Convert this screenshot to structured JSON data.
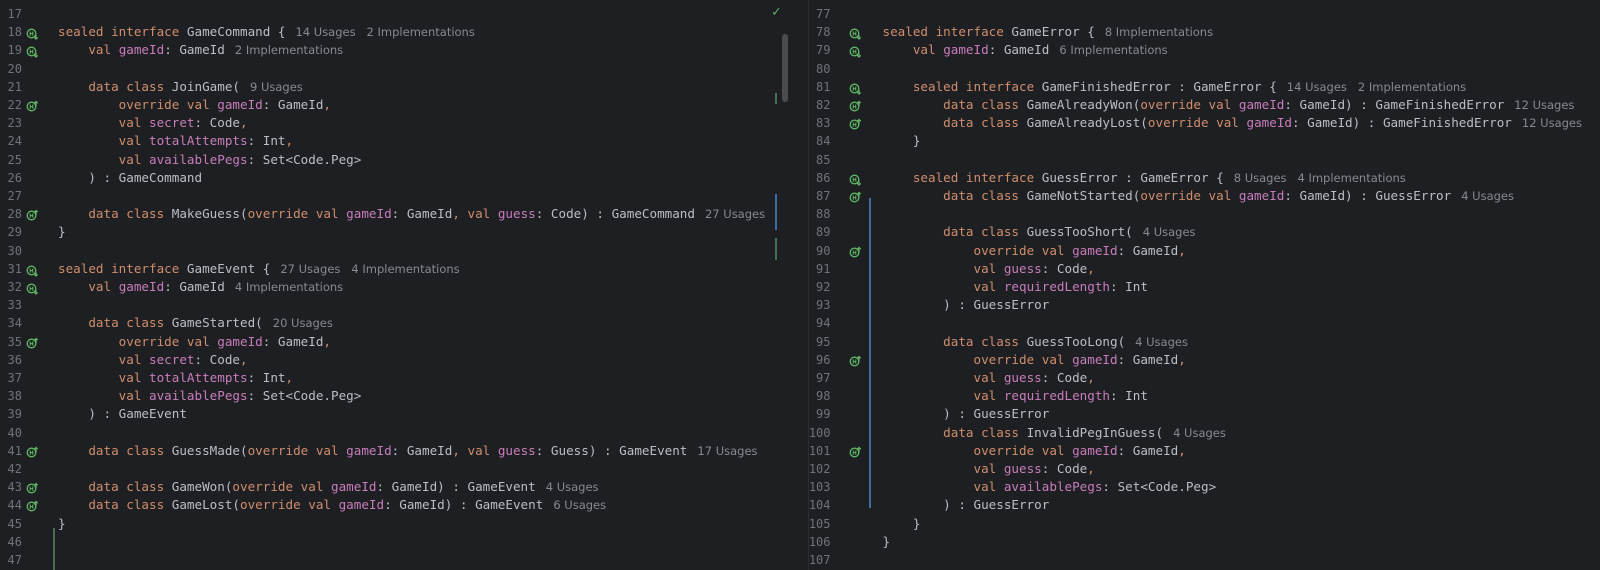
{
  "left": {
    "lines": [
      {
        "n": "17",
        "icon": "",
        "segs": []
      },
      {
        "n": "18",
        "icon": "impl",
        "segs": [
          [
            "kw",
            "sealed interface "
          ],
          [
            "ty",
            "GameCommand {"
          ]
        ],
        "hint": "14 Usages   2 Implementations"
      },
      {
        "n": "19",
        "icon": "impl",
        "segs": [
          [
            "ty",
            "    "
          ],
          [
            "kw",
            "val "
          ],
          [
            "prop",
            "gameId"
          ],
          [
            "ty",
            ": GameId"
          ]
        ],
        "hint": "2 Implementations"
      },
      {
        "n": "20",
        "icon": "",
        "segs": []
      },
      {
        "n": "21",
        "icon": "",
        "segs": [
          [
            "ty",
            "    "
          ],
          [
            "kw",
            "data class "
          ],
          [
            "ty",
            "JoinGame("
          ]
        ],
        "hint": "9 Usages"
      },
      {
        "n": "22",
        "icon": "override",
        "segs": [
          [
            "ty",
            "        "
          ],
          [
            "kw",
            "override val "
          ],
          [
            "prop",
            "gameId"
          ],
          [
            "ty",
            ": GameId"
          ],
          [
            "kw",
            ","
          ]
        ]
      },
      {
        "n": "23",
        "icon": "",
        "segs": [
          [
            "ty",
            "        "
          ],
          [
            "kw",
            "val "
          ],
          [
            "prop",
            "secret"
          ],
          [
            "ty",
            ": Code"
          ],
          [
            "kw",
            ","
          ]
        ]
      },
      {
        "n": "24",
        "icon": "",
        "segs": [
          [
            "ty",
            "        "
          ],
          [
            "kw",
            "val "
          ],
          [
            "prop",
            "totalAttempts"
          ],
          [
            "ty",
            ": Int"
          ],
          [
            "kw",
            ","
          ]
        ]
      },
      {
        "n": "25",
        "icon": "",
        "segs": [
          [
            "ty",
            "        "
          ],
          [
            "kw",
            "val "
          ],
          [
            "prop",
            "availablePegs"
          ],
          [
            "ty",
            ": Set<Code.Peg>"
          ]
        ]
      },
      {
        "n": "26",
        "icon": "",
        "segs": [
          [
            "ty",
            "    ) : GameCommand"
          ]
        ]
      },
      {
        "n": "27",
        "icon": "",
        "segs": []
      },
      {
        "n": "28",
        "icon": "override",
        "segs": [
          [
            "ty",
            "    "
          ],
          [
            "kw",
            "data class "
          ],
          [
            "ty",
            "MakeGuess("
          ],
          [
            "kw",
            "override val "
          ],
          [
            "prop",
            "gameId"
          ],
          [
            "ty",
            ": GameId"
          ],
          [
            "kw",
            ", val "
          ],
          [
            "prop",
            "guess"
          ],
          [
            "ty",
            ": Code) : GameCommand"
          ]
        ],
        "hint": "27 Usages"
      },
      {
        "n": "29",
        "icon": "",
        "segs": [
          [
            "ty",
            "}"
          ]
        ]
      },
      {
        "n": "30",
        "icon": "",
        "segs": []
      },
      {
        "n": "31",
        "icon": "impl",
        "segs": [
          [
            "kw",
            "sealed interface "
          ],
          [
            "ty",
            "GameEvent {"
          ]
        ],
        "hint": "27 Usages   4 Implementations"
      },
      {
        "n": "32",
        "icon": "impl",
        "segs": [
          [
            "ty",
            "    "
          ],
          [
            "kw",
            "val "
          ],
          [
            "prop",
            "gameId"
          ],
          [
            "ty",
            ": GameId"
          ]
        ],
        "hint": "4 Implementations"
      },
      {
        "n": "33",
        "icon": "",
        "segs": []
      },
      {
        "n": "34",
        "icon": "",
        "segs": [
          [
            "ty",
            "    "
          ],
          [
            "kw",
            "data class "
          ],
          [
            "ty",
            "GameStarted("
          ]
        ],
        "hint": "20 Usages"
      },
      {
        "n": "35",
        "icon": "override",
        "segs": [
          [
            "ty",
            "        "
          ],
          [
            "kw",
            "override val "
          ],
          [
            "prop",
            "gameId"
          ],
          [
            "ty",
            ": GameId"
          ],
          [
            "kw",
            ","
          ]
        ]
      },
      {
        "n": "36",
        "icon": "",
        "segs": [
          [
            "ty",
            "        "
          ],
          [
            "kw",
            "val "
          ],
          [
            "prop",
            "secret"
          ],
          [
            "ty",
            ": Code"
          ],
          [
            "kw",
            ","
          ]
        ]
      },
      {
        "n": "37",
        "icon": "",
        "segs": [
          [
            "ty",
            "        "
          ],
          [
            "kw",
            "val "
          ],
          [
            "prop",
            "totalAttempts"
          ],
          [
            "ty",
            ": Int"
          ],
          [
            "kw",
            ","
          ]
        ]
      },
      {
        "n": "38",
        "icon": "",
        "segs": [
          [
            "ty",
            "        "
          ],
          [
            "kw",
            "val "
          ],
          [
            "prop",
            "availablePegs"
          ],
          [
            "ty",
            ": Set<Code.Peg>"
          ]
        ]
      },
      {
        "n": "39",
        "icon": "",
        "segs": [
          [
            "ty",
            "    ) : GameEvent"
          ]
        ]
      },
      {
        "n": "40",
        "icon": "",
        "segs": []
      },
      {
        "n": "41",
        "icon": "override",
        "segs": [
          [
            "ty",
            "    "
          ],
          [
            "kw",
            "data class "
          ],
          [
            "ty",
            "GuessMade("
          ],
          [
            "kw",
            "override val "
          ],
          [
            "prop",
            "gameId"
          ],
          [
            "ty",
            ": GameId"
          ],
          [
            "kw",
            ", val "
          ],
          [
            "prop",
            "guess"
          ],
          [
            "ty",
            ": Guess) : GameEvent"
          ]
        ],
        "hint": "17 Usages"
      },
      {
        "n": "42",
        "icon": "",
        "segs": []
      },
      {
        "n": "43",
        "icon": "override",
        "segs": [
          [
            "ty",
            "    "
          ],
          [
            "kw",
            "data class "
          ],
          [
            "ty",
            "GameWon("
          ],
          [
            "kw",
            "override val "
          ],
          [
            "prop",
            "gameId"
          ],
          [
            "ty",
            ": GameId) : GameEvent"
          ]
        ],
        "hint": "4 Usages"
      },
      {
        "n": "44",
        "icon": "override",
        "segs": [
          [
            "ty",
            "    "
          ],
          [
            "kw",
            "data class "
          ],
          [
            "ty",
            "GameLost("
          ],
          [
            "kw",
            "override val "
          ],
          [
            "prop",
            "gameId"
          ],
          [
            "ty",
            ": GameId) : GameEvent"
          ]
        ],
        "hint": "6 Usages"
      },
      {
        "n": "45",
        "icon": "",
        "segs": [
          [
            "ty",
            "}"
          ]
        ]
      },
      {
        "n": "46",
        "icon": "",
        "segs": []
      },
      {
        "n": "47",
        "icon": "",
        "segs": []
      }
    ]
  },
  "right": {
    "lines": [
      {
        "n": "77",
        "icon": "",
        "segs": []
      },
      {
        "n": "78",
        "icon": "impl",
        "segs": [
          [
            "kw",
            "sealed interface "
          ],
          [
            "ty",
            "GameError {"
          ]
        ],
        "hint": "8 Implementations"
      },
      {
        "n": "79",
        "icon": "impl",
        "segs": [
          [
            "ty",
            "    "
          ],
          [
            "kw",
            "val "
          ],
          [
            "prop",
            "gameId"
          ],
          [
            "ty",
            ": GameId"
          ]
        ],
        "hint": "6 Implementations"
      },
      {
        "n": "80",
        "icon": "",
        "segs": []
      },
      {
        "n": "81",
        "icon": "impl",
        "segs": [
          [
            "ty",
            "    "
          ],
          [
            "kw",
            "sealed interface "
          ],
          [
            "ty",
            "GameFinishedError : GameError {"
          ]
        ],
        "hint": "14 Usages   2 Implementations"
      },
      {
        "n": "82",
        "icon": "override",
        "segs": [
          [
            "ty",
            "        "
          ],
          [
            "kw",
            "data class "
          ],
          [
            "ty",
            "GameAlreadyWon("
          ],
          [
            "kw",
            "override val "
          ],
          [
            "prop",
            "gameId"
          ],
          [
            "ty",
            ": GameId) : GameFinishedError"
          ]
        ],
        "hint": "12 Usages"
      },
      {
        "n": "83",
        "icon": "override",
        "segs": [
          [
            "ty",
            "        "
          ],
          [
            "kw",
            "data class "
          ],
          [
            "ty",
            "GameAlreadyLost("
          ],
          [
            "kw",
            "override val "
          ],
          [
            "prop",
            "gameId"
          ],
          [
            "ty",
            ": GameId) : GameFinishedError"
          ]
        ],
        "hint": "12 Usages"
      },
      {
        "n": "84",
        "icon": "",
        "segs": [
          [
            "ty",
            "    }"
          ]
        ]
      },
      {
        "n": "85",
        "icon": "",
        "segs": []
      },
      {
        "n": "86",
        "icon": "impl",
        "segs": [
          [
            "ty",
            "    "
          ],
          [
            "kw",
            "sealed interface "
          ],
          [
            "ty",
            "GuessError : GameError {"
          ]
        ],
        "hint": "8 Usages   4 Implementations"
      },
      {
        "n": "87",
        "icon": "override",
        "segs": [
          [
            "ty",
            "        "
          ],
          [
            "kw",
            "data class "
          ],
          [
            "ty",
            "GameNotStarted("
          ],
          [
            "kw",
            "override val "
          ],
          [
            "prop",
            "gameId"
          ],
          [
            "ty",
            ": GameId) : GuessError"
          ]
        ],
        "hint": "4 Usages"
      },
      {
        "n": "88",
        "icon": "",
        "segs": []
      },
      {
        "n": "89",
        "icon": "",
        "segs": [
          [
            "ty",
            "        "
          ],
          [
            "kw",
            "data class "
          ],
          [
            "ty",
            "GuessTooShort("
          ]
        ],
        "hint": "4 Usages"
      },
      {
        "n": "90",
        "icon": "override",
        "segs": [
          [
            "ty",
            "            "
          ],
          [
            "kw",
            "override val "
          ],
          [
            "prop",
            "gameId"
          ],
          [
            "ty",
            ": GameId"
          ],
          [
            "kw",
            ","
          ]
        ]
      },
      {
        "n": "91",
        "icon": "",
        "segs": [
          [
            "ty",
            "            "
          ],
          [
            "kw",
            "val "
          ],
          [
            "prop",
            "guess"
          ],
          [
            "ty",
            ": Code"
          ],
          [
            "kw",
            ","
          ]
        ]
      },
      {
        "n": "92",
        "icon": "",
        "segs": [
          [
            "ty",
            "            "
          ],
          [
            "kw",
            "val "
          ],
          [
            "prop",
            "requiredLength"
          ],
          [
            "ty",
            ": Int"
          ]
        ]
      },
      {
        "n": "93",
        "icon": "",
        "segs": [
          [
            "ty",
            "        ) : GuessError"
          ]
        ]
      },
      {
        "n": "94",
        "icon": "",
        "segs": []
      },
      {
        "n": "95",
        "icon": "",
        "segs": [
          [
            "ty",
            "        "
          ],
          [
            "kw",
            "data class "
          ],
          [
            "ty",
            "GuessTooLong("
          ]
        ],
        "hint": "4 Usages"
      },
      {
        "n": "96",
        "icon": "override",
        "segs": [
          [
            "ty",
            "            "
          ],
          [
            "kw",
            "override val "
          ],
          [
            "prop",
            "gameId"
          ],
          [
            "ty",
            ": GameId"
          ],
          [
            "kw",
            ","
          ]
        ]
      },
      {
        "n": "97",
        "icon": "",
        "segs": [
          [
            "ty",
            "            "
          ],
          [
            "kw",
            "val "
          ],
          [
            "prop",
            "guess"
          ],
          [
            "ty",
            ": Code"
          ],
          [
            "kw",
            ","
          ]
        ]
      },
      {
        "n": "98",
        "icon": "",
        "segs": [
          [
            "ty",
            "            "
          ],
          [
            "kw",
            "val "
          ],
          [
            "prop",
            "requiredLength"
          ],
          [
            "ty",
            ": Int"
          ]
        ]
      },
      {
        "n": "99",
        "icon": "",
        "segs": [
          [
            "ty",
            "        ) : GuessError"
          ]
        ]
      },
      {
        "n": "100",
        "icon": "",
        "segs": [
          [
            "ty",
            "        "
          ],
          [
            "kw",
            "data class "
          ],
          [
            "ty",
            "InvalidPegInGuess("
          ]
        ],
        "hint": "4 Usages"
      },
      {
        "n": "101",
        "icon": "override",
        "segs": [
          [
            "ty",
            "            "
          ],
          [
            "kw",
            "override val "
          ],
          [
            "prop",
            "gameId"
          ],
          [
            "ty",
            ": GameId"
          ],
          [
            "kw",
            ","
          ]
        ]
      },
      {
        "n": "102",
        "icon": "",
        "segs": [
          [
            "ty",
            "            "
          ],
          [
            "kw",
            "val "
          ],
          [
            "prop",
            "guess"
          ],
          [
            "ty",
            ": Code"
          ],
          [
            "kw",
            ","
          ]
        ]
      },
      {
        "n": "103",
        "icon": "",
        "segs": [
          [
            "ty",
            "            "
          ],
          [
            "kw",
            "val "
          ],
          [
            "prop",
            "availablePegs"
          ],
          [
            "ty",
            ": Set<Code.Peg>"
          ]
        ]
      },
      {
        "n": "104",
        "icon": "",
        "segs": [
          [
            "ty",
            "        ) : GuessError"
          ]
        ]
      },
      {
        "n": "105",
        "icon": "",
        "segs": [
          [
            "ty",
            "    }"
          ]
        ]
      },
      {
        "n": "106",
        "icon": "",
        "segs": [
          [
            "ty",
            "}"
          ]
        ]
      },
      {
        "n": "107",
        "icon": "",
        "segs": []
      }
    ]
  },
  "colors": {
    "background": "#1e1f22",
    "keyword": "#cf8e6d",
    "property": "#c77dbb",
    "text": "#bcbec4",
    "line_number": "#6f737a",
    "hint": "#868a91",
    "gutter_icon": "#5fb865",
    "modified_marker": "#3f6e9e",
    "added_marker": "#447152"
  },
  "status": {
    "inspection_icon": "check-icon"
  }
}
